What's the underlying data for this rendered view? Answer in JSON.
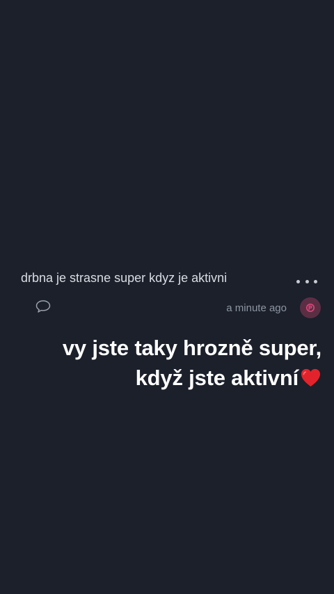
{
  "post": {
    "text": "drbna je strasne super kdyz je aktivni",
    "timestamp": "a minute ago",
    "more_icon": "more-dots-icon",
    "comment_icon": "speech-bubble-icon",
    "avatar_icon": "avatar-badge-icon"
  },
  "reply": {
    "line1": "vy jste taky hrozně super,",
    "line2": "když jste aktivní",
    "emoji": "red-heart-icon"
  },
  "colors": {
    "background": "#1b202b",
    "text": "#d9dde3",
    "muted": "#8f96a2",
    "accent": "#e0457b",
    "heart": "#e3232c"
  }
}
